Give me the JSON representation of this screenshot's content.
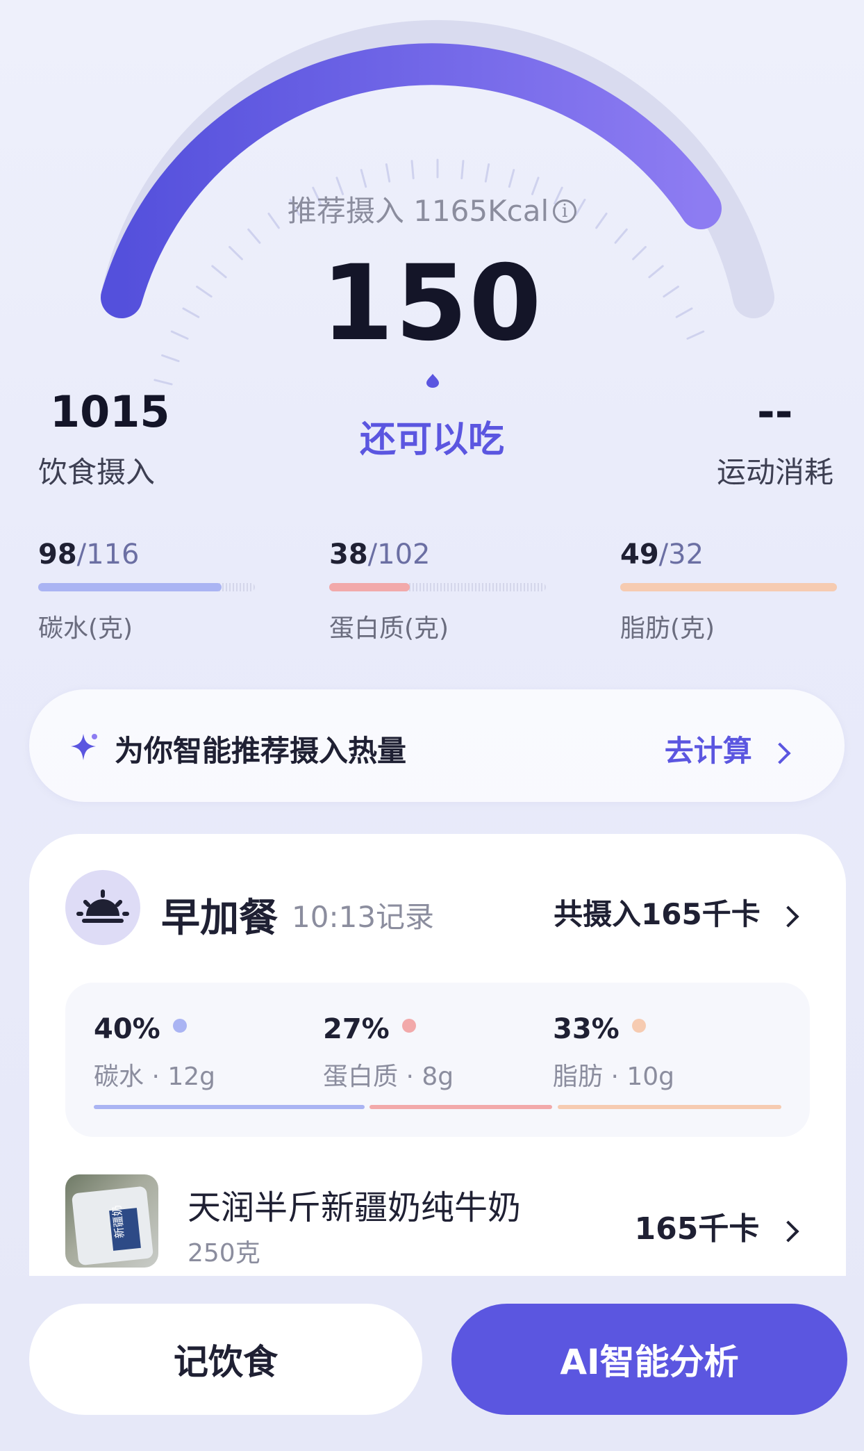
{
  "gauge": {
    "recommend_label": "推荐摄入 1165Kcal",
    "info_icon": "info-icon",
    "remaining_value": "150",
    "remaining_label": "还可以吃",
    "progress_fraction": 0.87,
    "colors": {
      "arc_start": "#5450dc",
      "arc_end": "#8d7cf2",
      "track": "#d9dbef"
    }
  },
  "intake": {
    "value": "1015",
    "label": "饮食摄入"
  },
  "exercise": {
    "value": "--",
    "label": "运动消耗"
  },
  "macros": [
    {
      "value": "98",
      "total": "/116",
      "name": "碳水(克)",
      "fraction": 0.845,
      "color": "#aab4f3"
    },
    {
      "value": "38",
      "total": "/102",
      "name": "蛋白质(克)",
      "fraction": 0.373,
      "color": "#f2a9aa"
    },
    {
      "value": "49",
      "total": "/32",
      "name": "脂肪(克)",
      "fraction": 1.0,
      "color": "#f6cbb1"
    }
  ],
  "recommend": {
    "icon": "sparkle-icon",
    "text": "为你智能推荐摄入热量",
    "action": "去计算"
  },
  "meal": {
    "icon": "sunrise-icon",
    "title": "早加餐",
    "time": "10:13记录",
    "total": "共摄入165千卡",
    "ratios": [
      {
        "pct": "40%",
        "label": "碳水 · 12g",
        "color": "#aab4f3"
      },
      {
        "pct": "27%",
        "label": "蛋白质 · 8g",
        "color": "#f2a9aa"
      },
      {
        "pct": "33%",
        "label": "脂肪 · 10g",
        "color": "#f6cbb1"
      }
    ],
    "food": {
      "name": "天润半斤新疆奶纯牛奶",
      "weight": "250克",
      "kcal": "165千卡",
      "package_text": "新疆奶"
    }
  },
  "actions": {
    "record": "记饮食",
    "ai": "AI智能分析"
  }
}
